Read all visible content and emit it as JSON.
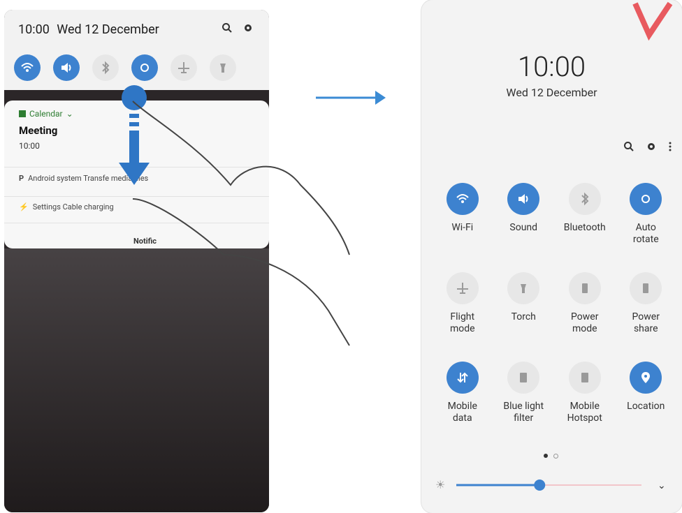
{
  "left_panel": {
    "status": {
      "time": "10:00",
      "date": "Wed 12 December"
    },
    "toggles": [
      {
        "icon": "wifi-icon",
        "on": true
      },
      {
        "icon": "sound-icon",
        "on": true
      },
      {
        "icon": "bluetooth-icon",
        "on": false
      },
      {
        "icon": "auto-rotate-icon",
        "on": true
      },
      {
        "icon": "airplane-icon",
        "on": false
      },
      {
        "icon": "torch-icon",
        "on": false
      }
    ],
    "notifications": {
      "calendar_app": "Calendar",
      "calendar_title": "Meeting",
      "calendar_time": "10:00",
      "android_line": "Android system  Transfe   media files",
      "settings_line": "Settings  Cable charging",
      "footer": "Notific"
    }
  },
  "right_panel": {
    "time": "10:00",
    "date": "Wed 12 December",
    "tiles": [
      {
        "label": "Wi-Fi",
        "icon": "wifi-icon",
        "on": true
      },
      {
        "label": "Sound",
        "icon": "sound-icon",
        "on": true
      },
      {
        "label": "Bluetooth",
        "icon": "bluetooth-icon",
        "on": false
      },
      {
        "label": "Auto\nrotate",
        "icon": "auto-rotate-icon",
        "on": true
      },
      {
        "label": "Flight\nmode",
        "icon": "airplane-icon",
        "on": false
      },
      {
        "label": "Torch",
        "icon": "torch-icon",
        "on": false
      },
      {
        "label": "Power\nmode",
        "icon": "power-mode-icon",
        "on": false
      },
      {
        "label": "Power\nshare",
        "icon": "power-share-icon",
        "on": false
      },
      {
        "label": "Mobile\ndata",
        "icon": "mobile-data-icon",
        "on": true
      },
      {
        "label": "Blue light\nfilter",
        "icon": "blue-light-filter-icon",
        "on": false
      },
      {
        "label": "Mobile\nHotspot",
        "icon": "hotspot-icon",
        "on": false
      },
      {
        "label": "Location",
        "icon": "location-icon",
        "on": true
      }
    ],
    "page_indicator": {
      "current": 1,
      "total": 2
    },
    "brightness": 0.45,
    "colors": {
      "accent": "#3d82cf",
      "tile_off": "#e7e7e7"
    }
  }
}
